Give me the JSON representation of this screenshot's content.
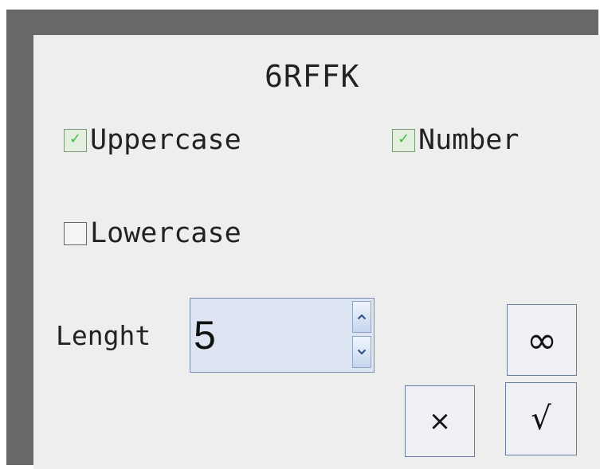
{
  "dialog": {
    "title": "6RFFK"
  },
  "options": {
    "uppercase": {
      "label": "Uppercase",
      "checked": true
    },
    "number": {
      "label": "Number",
      "checked": true
    },
    "lowercase": {
      "label": "Lowercase",
      "checked": false
    }
  },
  "length": {
    "label": "Lenght",
    "value": "5"
  },
  "buttons": {
    "infinity": "∞",
    "cancel": "×",
    "confirm": "√"
  },
  "colors": {
    "frame": "#686868",
    "panel": "#eeeeee",
    "check_mark": "#3cbf3c",
    "spinbox_bg": "#dde5f2",
    "button_border": "#6a7da0"
  }
}
